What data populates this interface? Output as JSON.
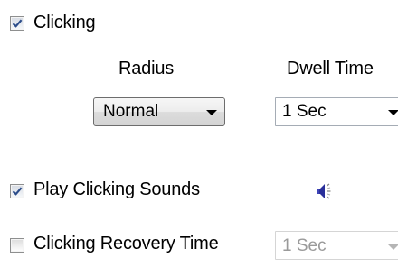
{
  "clicking": {
    "label": "Clicking",
    "checked": true
  },
  "headers": {
    "radius": "Radius",
    "dwell_time": "Dwell Time"
  },
  "radius_select": {
    "value": "Normal"
  },
  "dwell_select": {
    "value": "1 Sec"
  },
  "sounds": {
    "label": "Play Clicking Sounds",
    "checked": true,
    "icon": "speaker-icon"
  },
  "recovery": {
    "label": "Clicking Recovery Time",
    "checked": false,
    "value": "1 Sec",
    "disabled": true
  },
  "colors": {
    "check_mark": "#2c4d8a",
    "speaker_body": "#2a2f9a",
    "disabled_text": "#9a9a9a"
  }
}
